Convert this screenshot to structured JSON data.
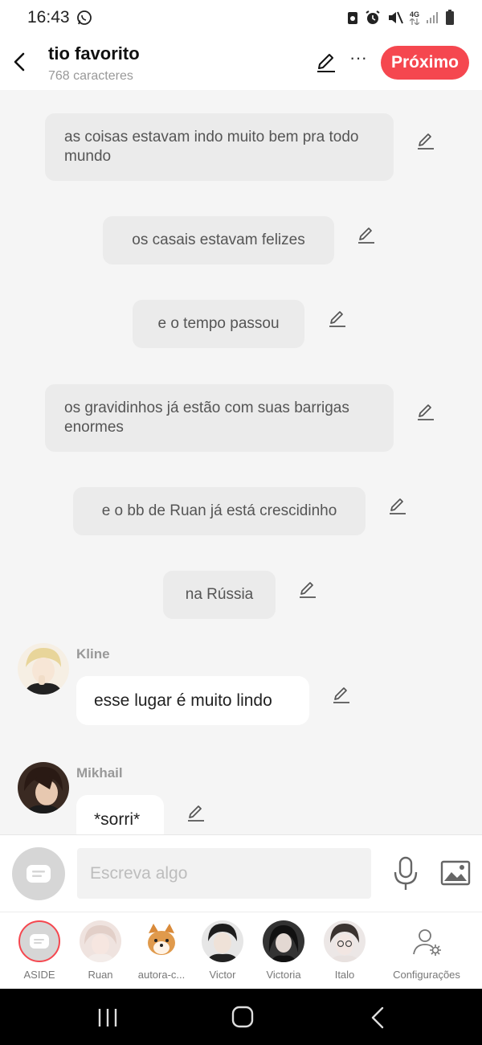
{
  "status_bar": {
    "time": "16:43",
    "network": "4G",
    "icons": [
      "whatsapp-icon",
      "recycle-icon",
      "alarm-icon",
      "mute-icon",
      "signal-icon",
      "battery-icon"
    ]
  },
  "header": {
    "title": "tio favorito",
    "subtitle": "768 caracteres",
    "next_label": "Próximo",
    "more_label": "···"
  },
  "narrations": [
    {
      "text": "as coisas estavam indo muito bem pra todo mundo"
    },
    {
      "text": "os casais estavam felizes"
    },
    {
      "text": "e o tempo passou"
    },
    {
      "text": "os gravidinhos já estão com suas barrigas enormes"
    },
    {
      "text": "e o bb de Ruan já está crescidinho"
    },
    {
      "text": "na Rússia"
    }
  ],
  "messages": [
    {
      "name": "Kline",
      "text": "esse lugar é muito lindo"
    },
    {
      "name": "Mikhail",
      "text": "*sorri*"
    }
  ],
  "composer": {
    "placeholder": "Escreva algo"
  },
  "characters": [
    {
      "label": "ASIDE"
    },
    {
      "label": "Ruan"
    },
    {
      "label": "autora-c..."
    },
    {
      "label": "Victor"
    },
    {
      "label": "Victoria"
    },
    {
      "label": "Italo"
    },
    {
      "label": "Configurações"
    }
  ],
  "colors": {
    "accent": "#f5474f",
    "narration_bg": "#ebebeb",
    "bubble_bg": "#ffffff",
    "background": "#f5f5f5"
  }
}
